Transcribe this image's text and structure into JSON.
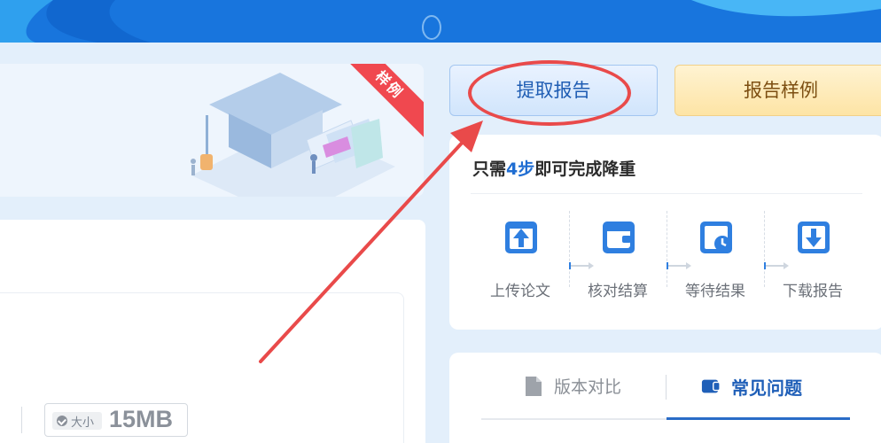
{
  "banner": {
    "ribbon_label": "样例"
  },
  "file_info": {
    "size_label": "大小",
    "size_value": "15MB"
  },
  "actions": {
    "get_report_label": "提取报告",
    "sample_report_label": "报告样例"
  },
  "steps": {
    "title_prefix": "只需",
    "title_highlight": "4步",
    "title_suffix": "即可完成降重",
    "items": [
      {
        "label": "上传论文",
        "icon": "upload-icon"
      },
      {
        "label": "核对结算",
        "icon": "wallet-icon"
      },
      {
        "label": "等待结果",
        "icon": "clock-icon"
      },
      {
        "label": "下载报告",
        "icon": "download-icon"
      }
    ]
  },
  "tabs": [
    {
      "label": "版本对比",
      "icon": "document-icon",
      "active": false
    },
    {
      "label": "常见问题",
      "icon": "book-icon",
      "active": true
    }
  ],
  "colors": {
    "accent": "#1f6dd2",
    "annotation": "#e94a4a",
    "topbar": "#1875dd"
  }
}
